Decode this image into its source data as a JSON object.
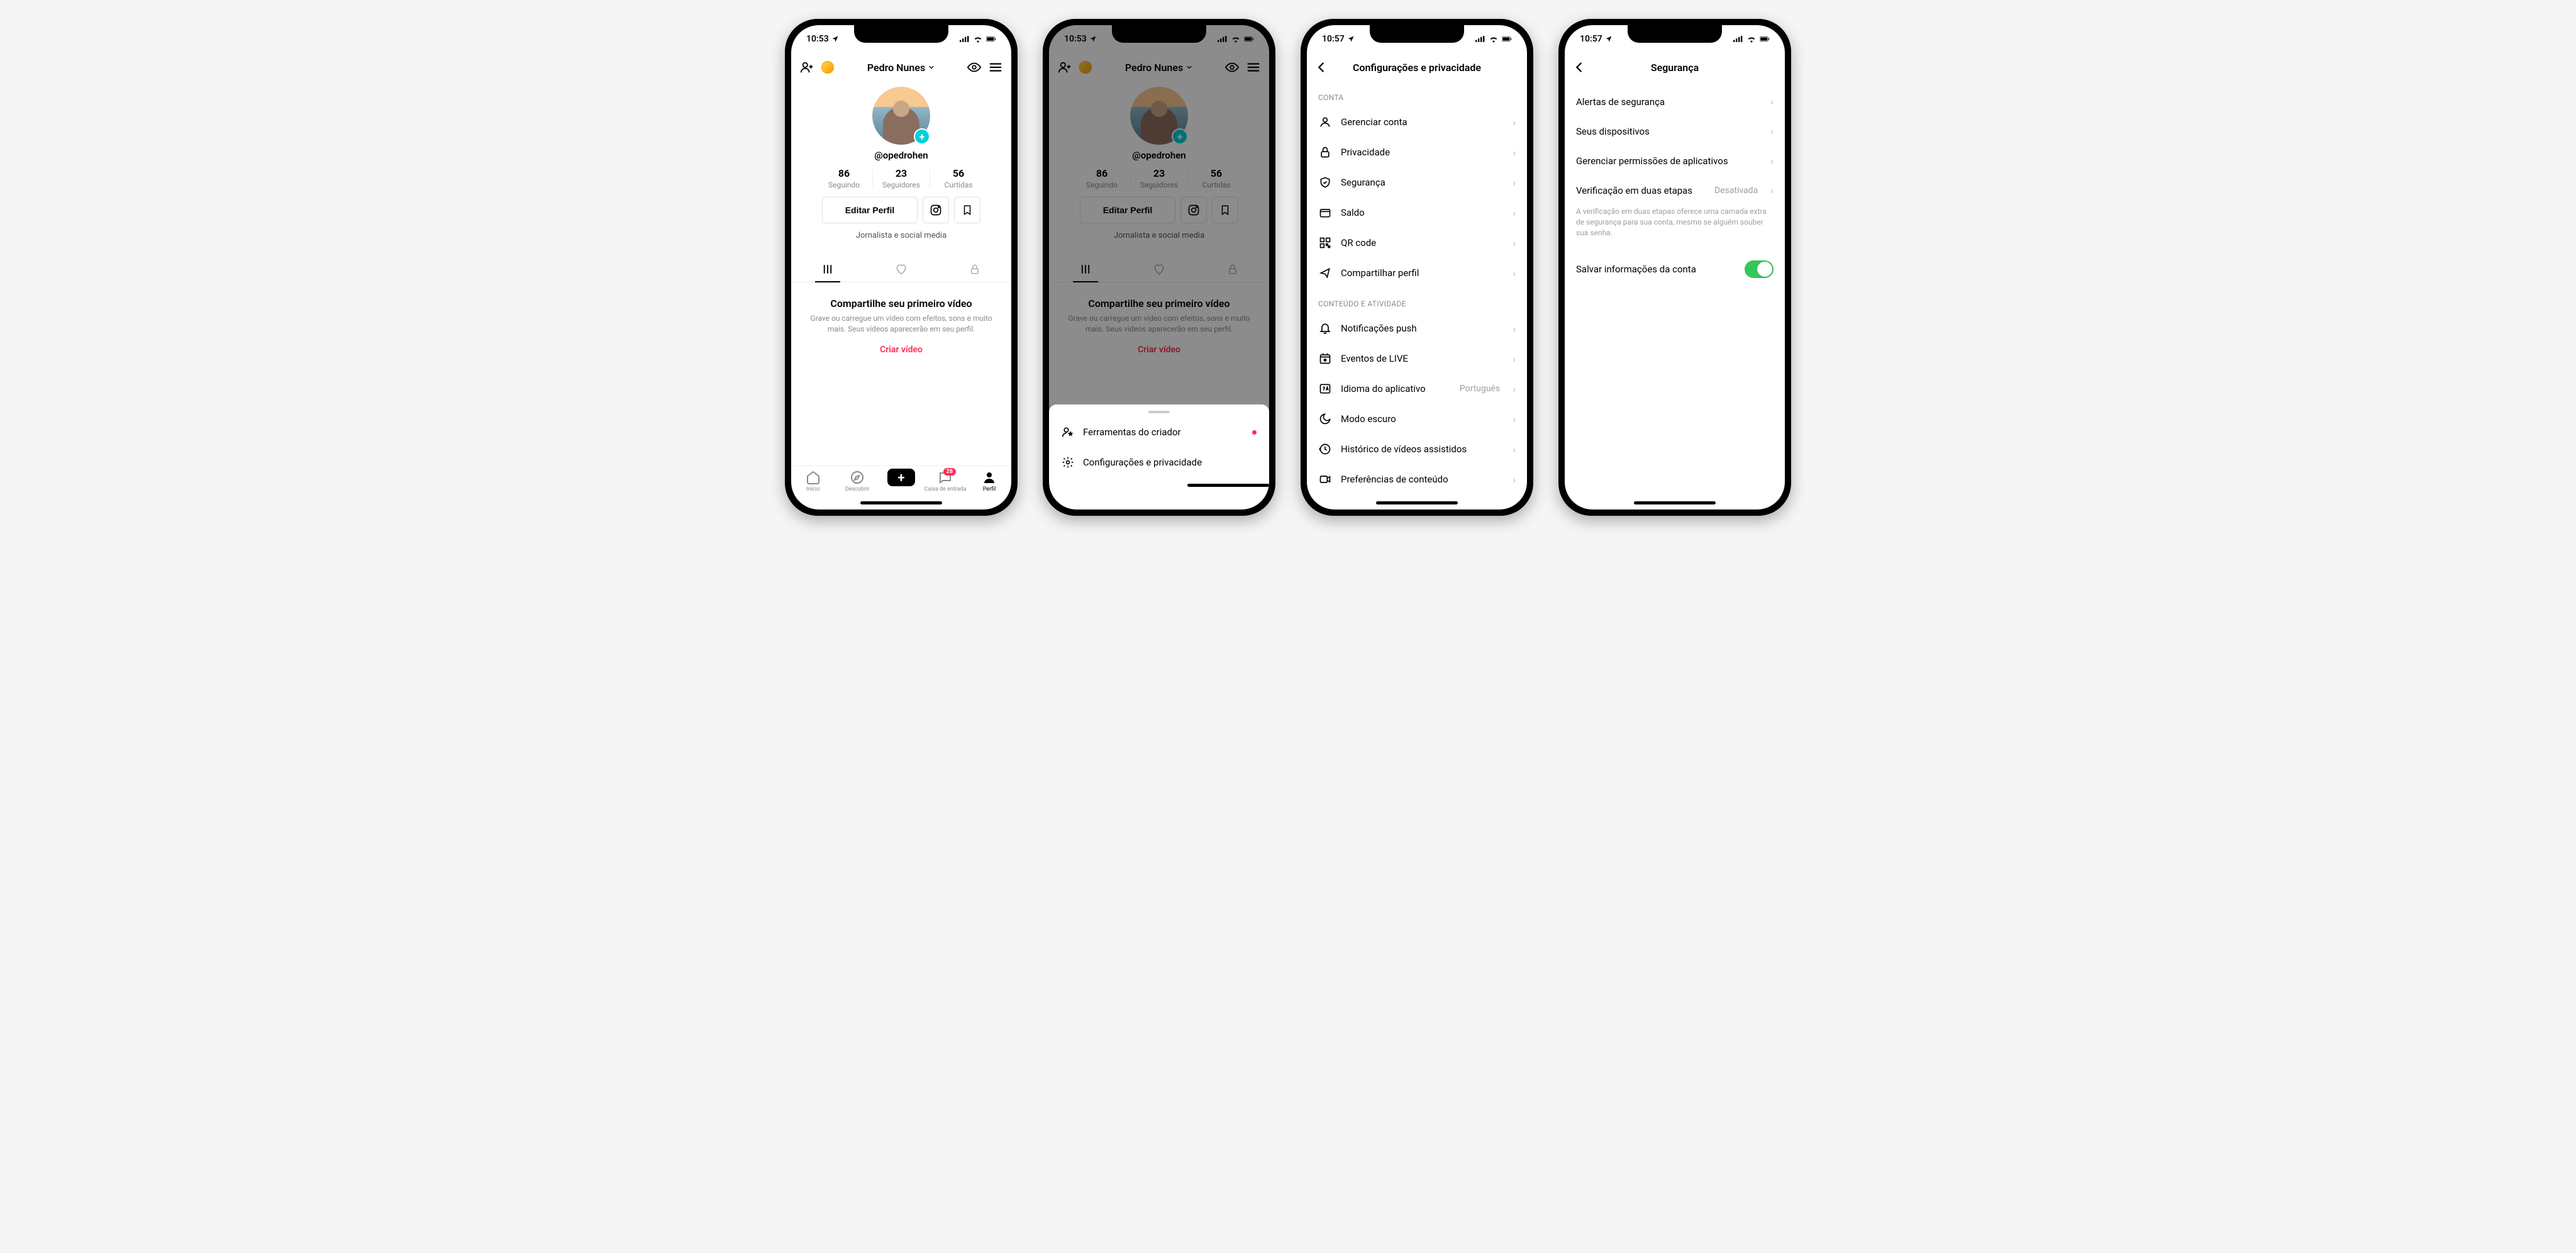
{
  "status": {
    "time1": "10:53",
    "time2": "10:57",
    "loc_icon": "location-arrow"
  },
  "profile": {
    "name": "Pedro Nunes",
    "handle": "@opedrohen",
    "stats": [
      {
        "num": "86",
        "label": "Seguindo"
      },
      {
        "num": "23",
        "label": "Seguidores"
      },
      {
        "num": "56",
        "label": "Curtidas"
      }
    ],
    "edit_label": "Editar Perfil",
    "bio": "Jornalista e social media",
    "empty_title": "Compartilhe seu primeiro vídeo",
    "empty_body": "Grave ou carregue um vídeo com efeitos, sons e muito mais. Seus vídeos aparecerão em seu perfil.",
    "empty_cta": "Criar vídeo"
  },
  "bottomnav": {
    "items": [
      "Início",
      "Descobrir",
      "",
      "Caixa de entrada",
      "Perfil"
    ],
    "badge": "28"
  },
  "sheet": {
    "items": [
      {
        "label": "Ferramentas do criador",
        "dot": true
      },
      {
        "label": "Configurações e privacidade",
        "dot": false
      }
    ]
  },
  "settings": {
    "title": "Configurações e privacidade",
    "sections": [
      {
        "header": "CONTA",
        "items": [
          {
            "icon": "person",
            "label": "Gerenciar conta"
          },
          {
            "icon": "lock",
            "label": "Privacidade"
          },
          {
            "icon": "shield",
            "label": "Segurança"
          },
          {
            "icon": "wallet",
            "label": "Saldo"
          },
          {
            "icon": "qr",
            "label": "QR code"
          },
          {
            "icon": "share",
            "label": "Compartilhar perfil"
          }
        ]
      },
      {
        "header": "CONTEÚDO E ATIVIDADE",
        "items": [
          {
            "icon": "bell",
            "label": "Notificações push"
          },
          {
            "icon": "live",
            "label": "Eventos de LIVE"
          },
          {
            "icon": "lang",
            "label": "Idioma do aplicativo",
            "value": "Português"
          },
          {
            "icon": "moon",
            "label": "Modo escuro"
          },
          {
            "icon": "history",
            "label": "Histórico de vídeos assistidos"
          },
          {
            "icon": "video",
            "label": "Preferências de conteúdo"
          }
        ]
      }
    ]
  },
  "security": {
    "title": "Segurança",
    "items": [
      {
        "label": "Alertas de segurança"
      },
      {
        "label": "Seus dispositivos"
      },
      {
        "label": "Gerenciar permissões de aplicativos"
      },
      {
        "label": "Verificação em duas etapas",
        "value": "Desativada"
      }
    ],
    "twofa_desc": "A verificação em duas etapas oferece uma camada extra de segurança para sua conta, mesmo se alguém souber sua senha.",
    "save_label": "Salvar informações da conta"
  }
}
